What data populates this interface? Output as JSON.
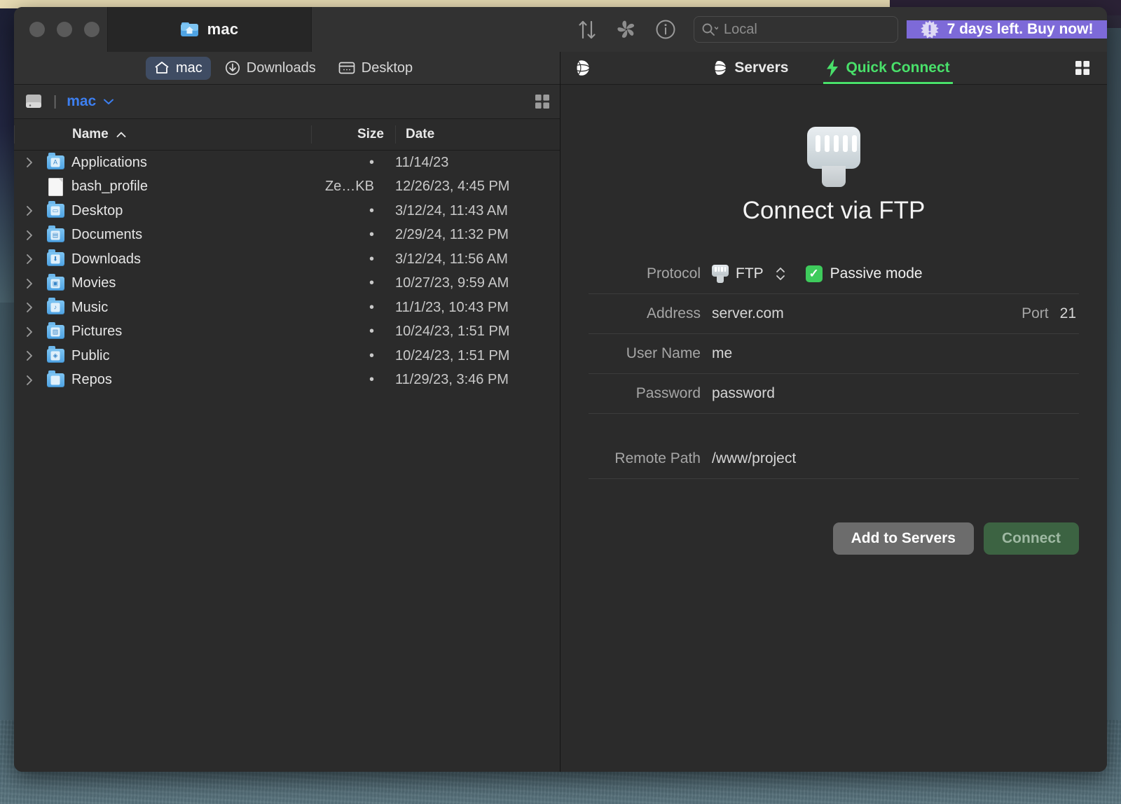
{
  "window": {
    "title": "mac",
    "title_icon": "home-folder-icon"
  },
  "toolbar": {
    "transfers_icon": "transfers-arrows-icon",
    "sync_icon": "sync-pinwheel-icon",
    "info_icon": "info-circle-icon",
    "search": {
      "icon": "search-magnifier-icon",
      "placeholder": "Local",
      "value": ""
    },
    "banner": {
      "icon": "burst-badge-icon",
      "label": "7 days left. Buy now!",
      "color": "#7d6ad8"
    }
  },
  "left_pane": {
    "favorites": [
      {
        "label": "mac",
        "icon": "home-icon",
        "active": true
      },
      {
        "label": "Downloads",
        "icon": "download-circle-icon",
        "active": false
      },
      {
        "label": "Desktop",
        "icon": "desktop-window-icon",
        "active": false
      }
    ],
    "path_bar": {
      "drive_icon": "hard-drive-icon",
      "separator": "|",
      "crumb": "mac",
      "chevron": "˅",
      "view_toggle_icon": "grid-view-icon"
    },
    "columns": {
      "name": "Name",
      "sort_arrow": "^",
      "size": "Size",
      "date": "Date"
    },
    "rows": [
      {
        "name": "Applications",
        "size": "•",
        "date": "11/14/23",
        "type": "folder",
        "glyph": "A",
        "expandable": true
      },
      {
        "name": "bash_profile",
        "size": "Ze…KB",
        "date": "12/26/23, 4:45 PM",
        "type": "file",
        "glyph": "",
        "expandable": false
      },
      {
        "name": "Desktop",
        "size": "•",
        "date": "3/12/24, 11:43 AM",
        "type": "folder",
        "glyph": "▭",
        "expandable": true
      },
      {
        "name": "Documents",
        "size": "•",
        "date": "2/29/24, 11:32 PM",
        "type": "folder",
        "glyph": "▤",
        "expandable": true
      },
      {
        "name": "Downloads",
        "size": "•",
        "date": "3/12/24, 11:56 AM",
        "type": "folder",
        "glyph": "⬇",
        "expandable": true
      },
      {
        "name": "Movies",
        "size": "•",
        "date": "10/27/23, 9:59 AM",
        "type": "folder",
        "glyph": "▣",
        "expandable": true
      },
      {
        "name": "Music",
        "size": "•",
        "date": "11/1/23, 10:43 PM",
        "type": "folder",
        "glyph": "♪",
        "expandable": true
      },
      {
        "name": "Pictures",
        "size": "•",
        "date": "10/24/23, 1:51 PM",
        "type": "folder",
        "glyph": "▨",
        "expandable": true
      },
      {
        "name": "Public",
        "size": "•",
        "date": "10/24/23, 1:51 PM",
        "type": "folder",
        "glyph": "◈",
        "expandable": true
      },
      {
        "name": "Repos",
        "size": "•",
        "date": "11/29/23, 3:46 PM",
        "type": "folder",
        "glyph": "",
        "expandable": true
      }
    ]
  },
  "right_pane": {
    "left_globe_icon": "globe-icon",
    "tabs": [
      {
        "label": "Servers",
        "icon": "globe-icon",
        "active": false
      },
      {
        "label": "Quick Connect",
        "icon": "lightning-bolt-icon",
        "active": true
      }
    ],
    "active_tab_color": "#49e06a",
    "view_toggle_icon": "grid-view-icon",
    "hero_icon": "ethernet-plug-icon",
    "title": "Connect via FTP",
    "form": {
      "protocol_label": "Protocol",
      "protocol_value": "FTP",
      "protocol_icon": "ethernet-plug-icon",
      "stepper_icon": "up-down-stepper-icon",
      "passive_label": "Passive mode",
      "passive_checked": true,
      "passive_check_color": "#3ecb5c",
      "address_label": "Address",
      "address_value": "server.com",
      "port_label": "Port",
      "port_value": "21",
      "username_label": "User Name",
      "username_value": "me",
      "password_label": "Password",
      "password_value": "password",
      "remote_path_label": "Remote Path",
      "remote_path_value": "/www/project"
    },
    "buttons": {
      "add_label": "Add to Servers",
      "connect_label": "Connect"
    }
  }
}
